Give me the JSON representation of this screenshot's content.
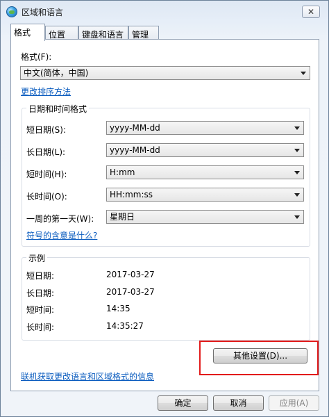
{
  "window": {
    "title": "区域和语言",
    "close": "✕"
  },
  "tabs": [
    {
      "label": "格式"
    },
    {
      "label": "位置"
    },
    {
      "label": "键盘和语言"
    },
    {
      "label": "管理"
    }
  ],
  "format": {
    "label": "格式(F):",
    "value": "中文(简体，中国)",
    "change_sort_link": "更改排序方法"
  },
  "datetime": {
    "group_title": "日期和时间格式",
    "rows": [
      {
        "label": "短日期(S):",
        "value": "yyyy-MM-dd"
      },
      {
        "label": "长日期(L):",
        "value": "yyyy-MM-dd"
      },
      {
        "label": "短时间(H):",
        "value": "H:mm"
      },
      {
        "label": "长时间(O):",
        "value": "HH:mm:ss"
      },
      {
        "label": "一周的第一天(W):",
        "value": "星期日"
      }
    ],
    "symbols_link": "符号的含意是什么?"
  },
  "example": {
    "group_title": "示例",
    "rows": [
      {
        "label": "短日期:",
        "value": "2017-03-27"
      },
      {
        "label": "长日期:",
        "value": "2017-03-27"
      },
      {
        "label": "短时间:",
        "value": "14:35"
      },
      {
        "label": "长时间:",
        "value": "14:35:27"
      }
    ]
  },
  "other_settings_button": "其他设置(D)...",
  "online_info_link": "联机获取更改语言和区域格式的信息",
  "footer": {
    "ok": "确定",
    "cancel": "取消",
    "apply": "应用(A)"
  }
}
